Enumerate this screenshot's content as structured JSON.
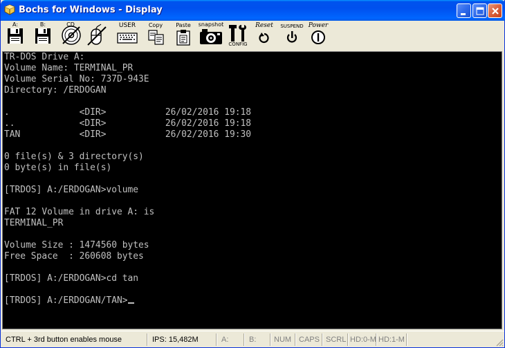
{
  "window": {
    "title": "Bochs for Windows - Display",
    "controls": [
      "minimize",
      "maximize",
      "close"
    ]
  },
  "toolbar": {
    "items": [
      {
        "id": "floppy-a",
        "label": "A:",
        "icon": "floppy-disk-icon"
      },
      {
        "id": "floppy-b",
        "label": "B:",
        "icon": "floppy-disk-icon"
      },
      {
        "id": "cdrom",
        "label": "CD",
        "icon": "cdrom-icon"
      },
      {
        "id": "mouse",
        "label": "",
        "icon": "mouse-disabled-icon"
      },
      {
        "id": "user",
        "label": "USER",
        "icon": "keyboard-icon"
      },
      {
        "id": "copy",
        "label": "Copy",
        "icon": "copy-icon"
      },
      {
        "id": "paste",
        "label": "Paste",
        "icon": "paste-icon"
      },
      {
        "id": "snapshot",
        "label": "snapshot",
        "icon": "camera-icon"
      },
      {
        "id": "config",
        "label": "CONFIG",
        "icon": "config-icon"
      },
      {
        "id": "reset",
        "label": "Reset",
        "icon": "reset-icon"
      },
      {
        "id": "suspend",
        "label": "SUSPEND",
        "icon": "suspend-icon"
      },
      {
        "id": "power",
        "label": "Power",
        "icon": "power-icon"
      }
    ]
  },
  "console": {
    "lines": [
      "TR-DOS Drive A:",
      "Volume Name: TERMINAL_PR",
      "Volume Serial No: 737D-943E",
      "Directory: /ERDOGAN",
      "",
      ".             <DIR>           26/02/2016 19:18",
      "..            <DIR>           26/02/2016 19:18",
      "TAN           <DIR>           26/02/2016 19:30",
      "",
      "0 file(s) & 3 directory(s)",
      "0 byte(s) in file(s)",
      "",
      "[TRDOS] A:/ERDOGAN>volume",
      "",
      "FAT 12 Volume in drive A: is",
      "TERMINAL_PR",
      "",
      "Volume Size : 1474560 bytes",
      "Free Space  : 260608 bytes",
      "",
      "[TRDOS] A:/ERDOGAN>cd tan",
      "",
      "[TRDOS] A:/ERDOGAN/TAN>"
    ]
  },
  "statusbar": {
    "mouse_hint": "CTRL + 3rd button enables mouse",
    "ips": "IPS: 15,482M",
    "drive_a": "A:",
    "drive_b": "B:",
    "num": "NUM",
    "caps": "CAPS",
    "scrl": "SCRL",
    "hd0": "HD:0-M",
    "hd1": "HD:1-M"
  }
}
